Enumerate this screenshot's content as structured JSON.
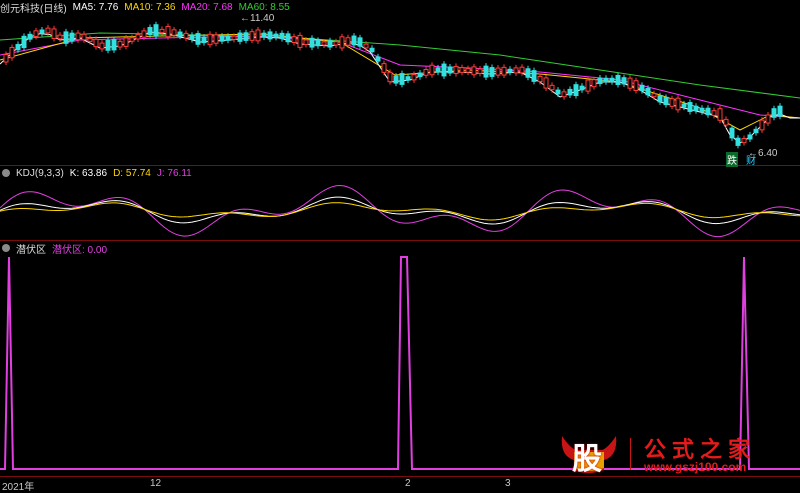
{
  "main_panel": {
    "title": "创元科技(日线)",
    "ma": [
      {
        "label": "MA5: 7.76",
        "color": "#ffffff"
      },
      {
        "label": "MA10: 7.36",
        "color": "#ffd700"
      },
      {
        "label": "MA20: 7.68",
        "color": "#ff33ff"
      },
      {
        "label": "MA60: 8.55",
        "color": "#33cc33"
      }
    ],
    "high_label": "11.40",
    "low_label": "6.40",
    "tags": [
      "跌",
      "财"
    ]
  },
  "kdj_panel": {
    "title": "KDJ(9,3,3)",
    "k": "K: 63.86",
    "d": "D: 57.74",
    "j": "J: 76.11"
  },
  "qfq_panel": {
    "title": "潜伏区",
    "value_label": "潜伏区: 0.00"
  },
  "x_axis": {
    "ticks": [
      "2021年",
      "12",
      "2",
      "3"
    ]
  },
  "watermark": {
    "badge": "股",
    "title": "公式之家",
    "url": "www.gszj100.com"
  },
  "colors": {
    "up": "#ff3b3b",
    "down": "#33e0e0",
    "grid": "#7a0c0c",
    "magenta": "#e040e0"
  }
}
